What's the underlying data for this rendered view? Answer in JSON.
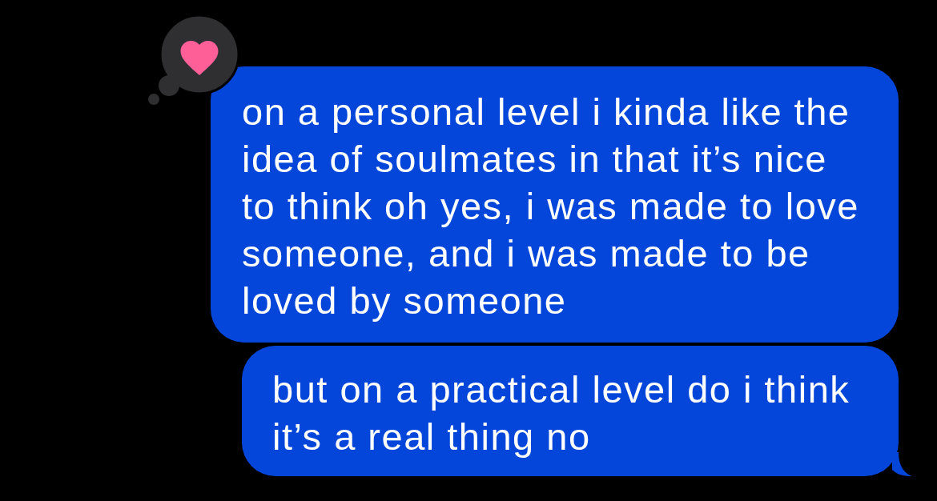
{
  "messages": [
    {
      "text": "on a personal level i kinda like the idea of soulmates in that it’s nice to think oh yes, i was made to love someone, and i was made to be loved by someone",
      "reaction": true,
      "tail": false
    },
    {
      "text": "but on a practical level do i think it’s a real thing no",
      "reaction": false,
      "tail": true
    }
  ]
}
